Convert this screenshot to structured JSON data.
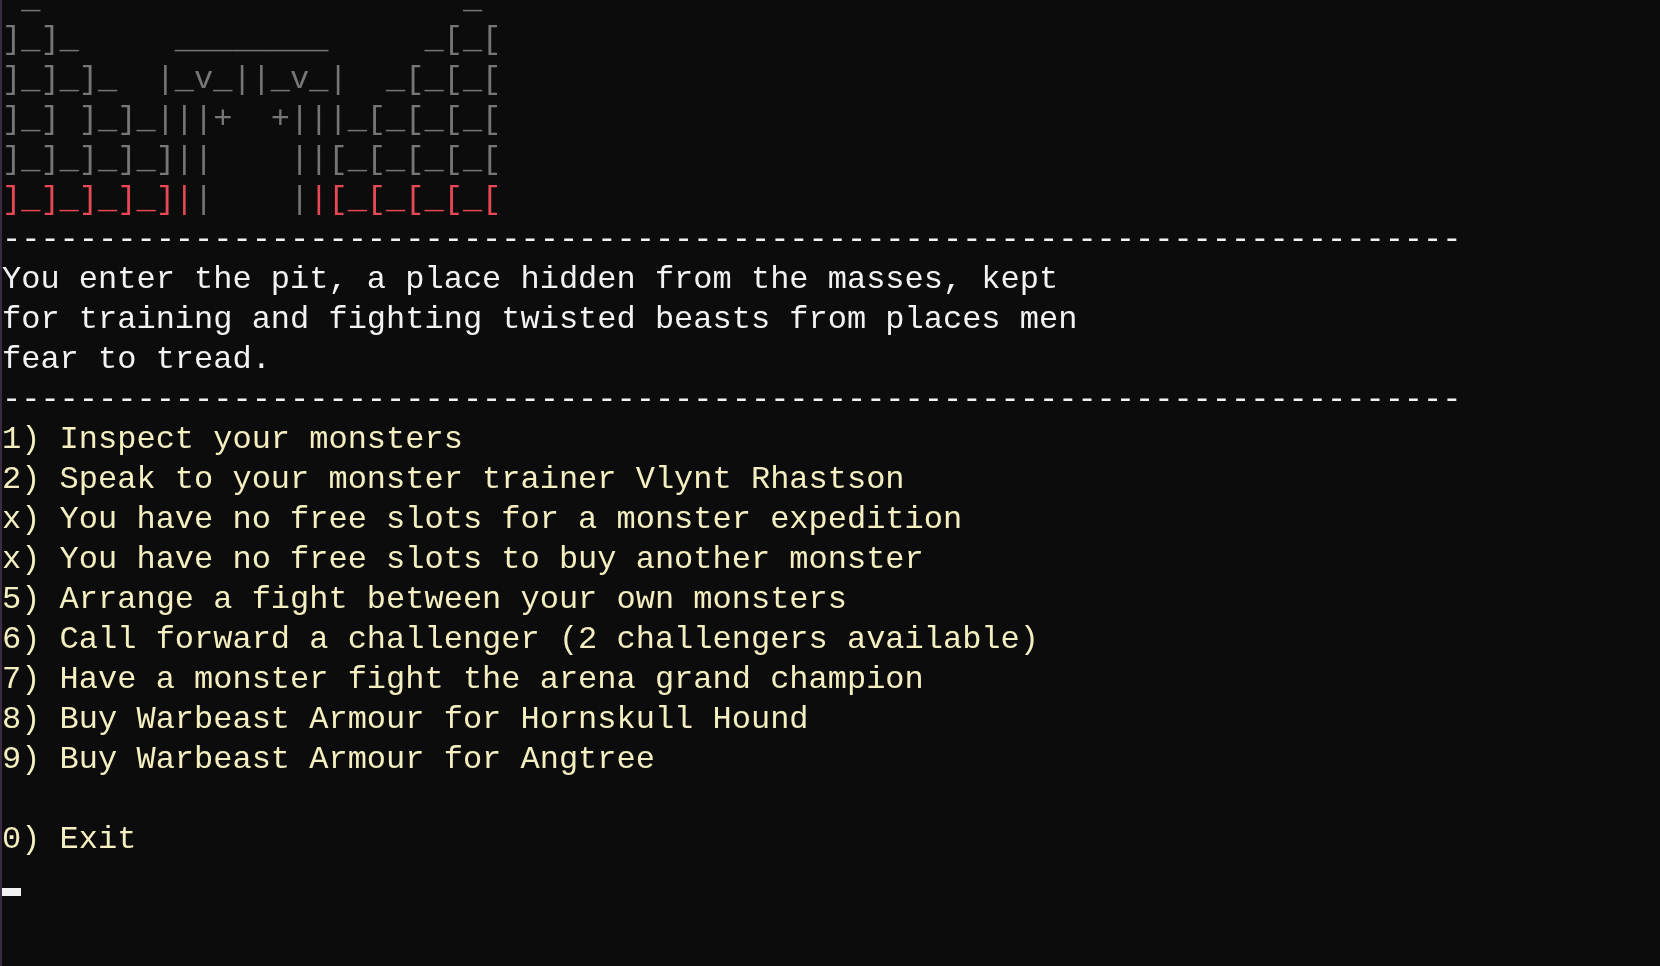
{
  "ascii_art": [
    [
      {
        "text": " _                      _",
        "color": "#767676"
      }
    ],
    [
      {
        "text": "]_]_     ________     _[_[",
        "color": "#767676"
      }
    ],
    [
      {
        "text": "]_]_]_  |_v_||_v_|  _[_[_[",
        "color": "#767676"
      }
    ],
    [
      {
        "text": "]_] ]_]_|||+  +|||_[_[_[_[",
        "color": "#767676"
      }
    ],
    [
      {
        "text": "]_]_]_]_]||    ||[_[_[_[_[",
        "color": "#767676"
      }
    ],
    [
      {
        "text": "]_]_]_]_]|",
        "color": "#e74856"
      },
      {
        "text": "|    |",
        "color": "#767676"
      },
      {
        "text": "|[_[_[_[_[",
        "color": "#e74856"
      }
    ]
  ],
  "separator_top": "----------------------------------------------------------------------------",
  "description": [
    "You enter the pit, a place hidden from the masses, kept",
    "for training and fighting twisted beasts from places men",
    "fear to tread."
  ],
  "separator_bottom": "----------------------------------------------------------------------------",
  "menu": [
    "1) Inspect your monsters",
    "2) Speak to your monster trainer Vlynt Rhastson",
    "x) You have no free slots for a monster expedition",
    "x) You have no free slots to buy another monster",
    "5) Arrange a fight between your own monsters",
    "6) Call forward a challenger (2 challengers available)",
    "7) Have a monster fight the arena grand champion",
    "8) Buy Warbeast Armour for Hornskull Hound",
    "9) Buy Warbeast Armour for Angtree"
  ],
  "exit": "0) Exit"
}
